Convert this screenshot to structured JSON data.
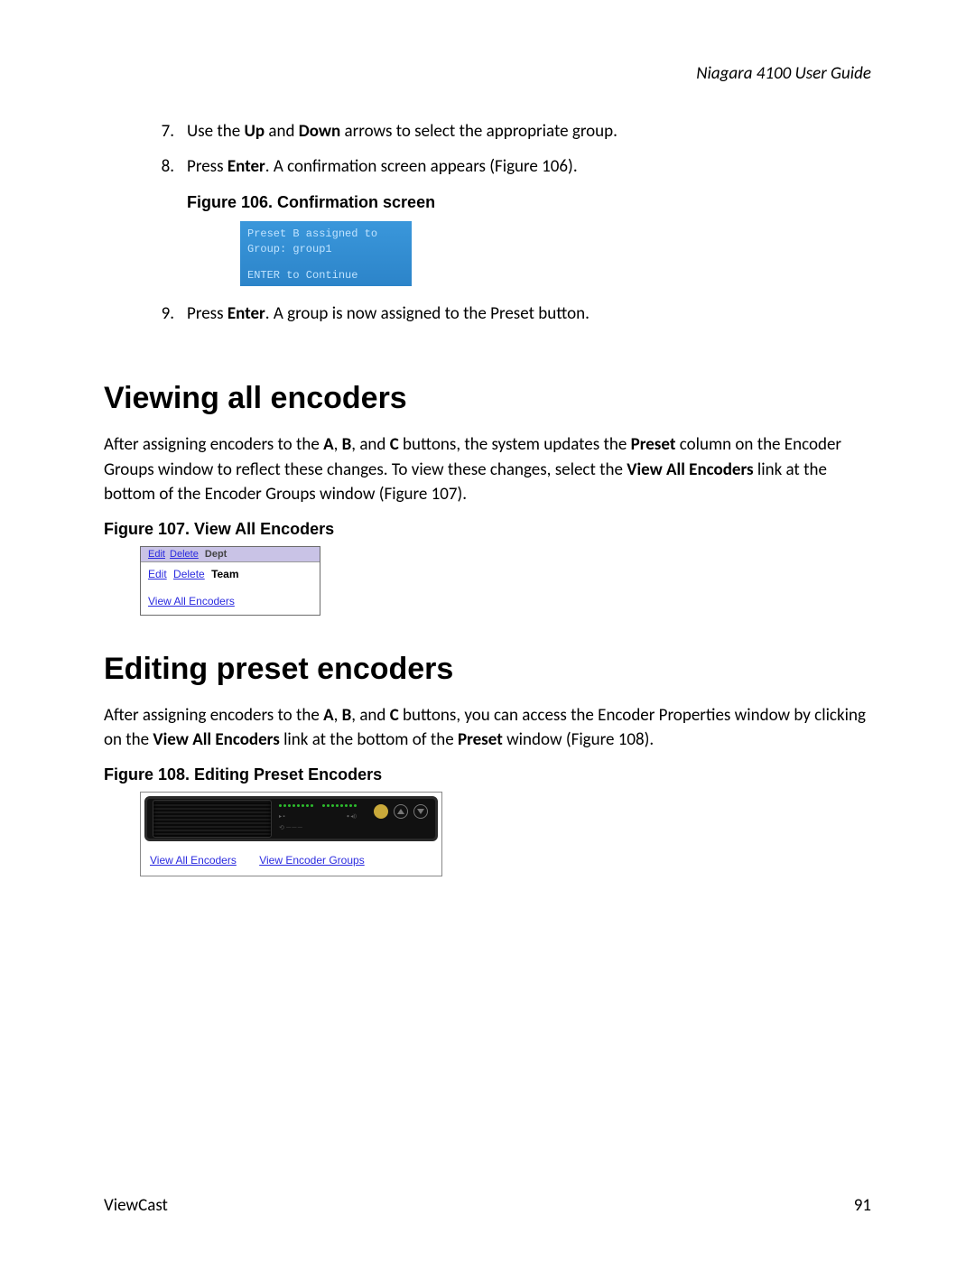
{
  "header": {
    "guide_title": "Niagara 4100 User Guide"
  },
  "steps": [
    {
      "num": "7.",
      "pre": "Use the ",
      "b1": "Up",
      "mid1": " and ",
      "b2": "Down",
      "post": " arrows to select the appropriate group."
    },
    {
      "num": "8.",
      "pre": "Press ",
      "b1": "Enter",
      "post": ". A confirmation screen appears (Figure 106)."
    },
    {
      "num": "9.",
      "pre": "Press ",
      "b1": "Enter",
      "post": ". A group is now assigned to the Preset button."
    }
  ],
  "fig106": {
    "caption": "Figure 106. Confirmation screen",
    "line1": "Preset B assigned to",
    "line2": "Group: group1",
    "line3": "ENTER to Continue"
  },
  "section1": {
    "heading": "Viewing all encoders",
    "para_pre": "After assigning encoders to the ",
    "bA": "A",
    "c1": ", ",
    "bB": "B",
    "c2": ", and ",
    "bC": "C",
    "mid1": " buttons, the system updates the ",
    "bPreset": "Preset",
    "mid2": " column on the Encoder Groups window to reflect these changes. To view these changes, select the ",
    "bView": "View All Encoders",
    "post": " link at the bottom of the Encoder Groups window (Figure 107)."
  },
  "fig107": {
    "caption": "Figure 107. View All Encoders",
    "top_edit": "Edit",
    "top_delete": "Delete",
    "top_name": "Dept",
    "row_edit": "Edit",
    "row_delete": "Delete",
    "row_name": "Team",
    "view_all": "View All Encoders"
  },
  "section2": {
    "heading": "Editing preset encoders",
    "para_pre": "After assigning encoders to the ",
    "bA": "A",
    "c1": ", ",
    "bB": "B",
    "c2": ", and ",
    "bC": "C",
    "mid1": " buttons, you can access the Encoder Properties window by clicking on the ",
    "bView": "View All Encoders",
    "mid2": " link at the bottom of the ",
    "bPreset": "Preset",
    "post": " window (Figure 108)."
  },
  "fig108": {
    "caption": "Figure 108. Editing Preset Encoders",
    "link1": "View All Encoders",
    "link2": "View Encoder Groups"
  },
  "footer": {
    "left": "ViewCast",
    "right": "91"
  }
}
